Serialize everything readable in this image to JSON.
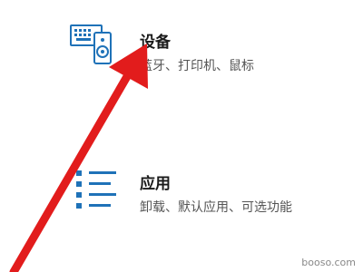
{
  "settings": {
    "devices": {
      "title": "设备",
      "description": "蓝牙、打印机、鼠标",
      "icon": "devices-icon"
    },
    "apps": {
      "title": "应用",
      "description": "卸载、默认应用、可选功能",
      "icon": "apps-list-icon"
    }
  },
  "annotation": {
    "arrow_color": "#e21c1c",
    "icon_color": "#1f72b8"
  },
  "watermark": "booso.com"
}
